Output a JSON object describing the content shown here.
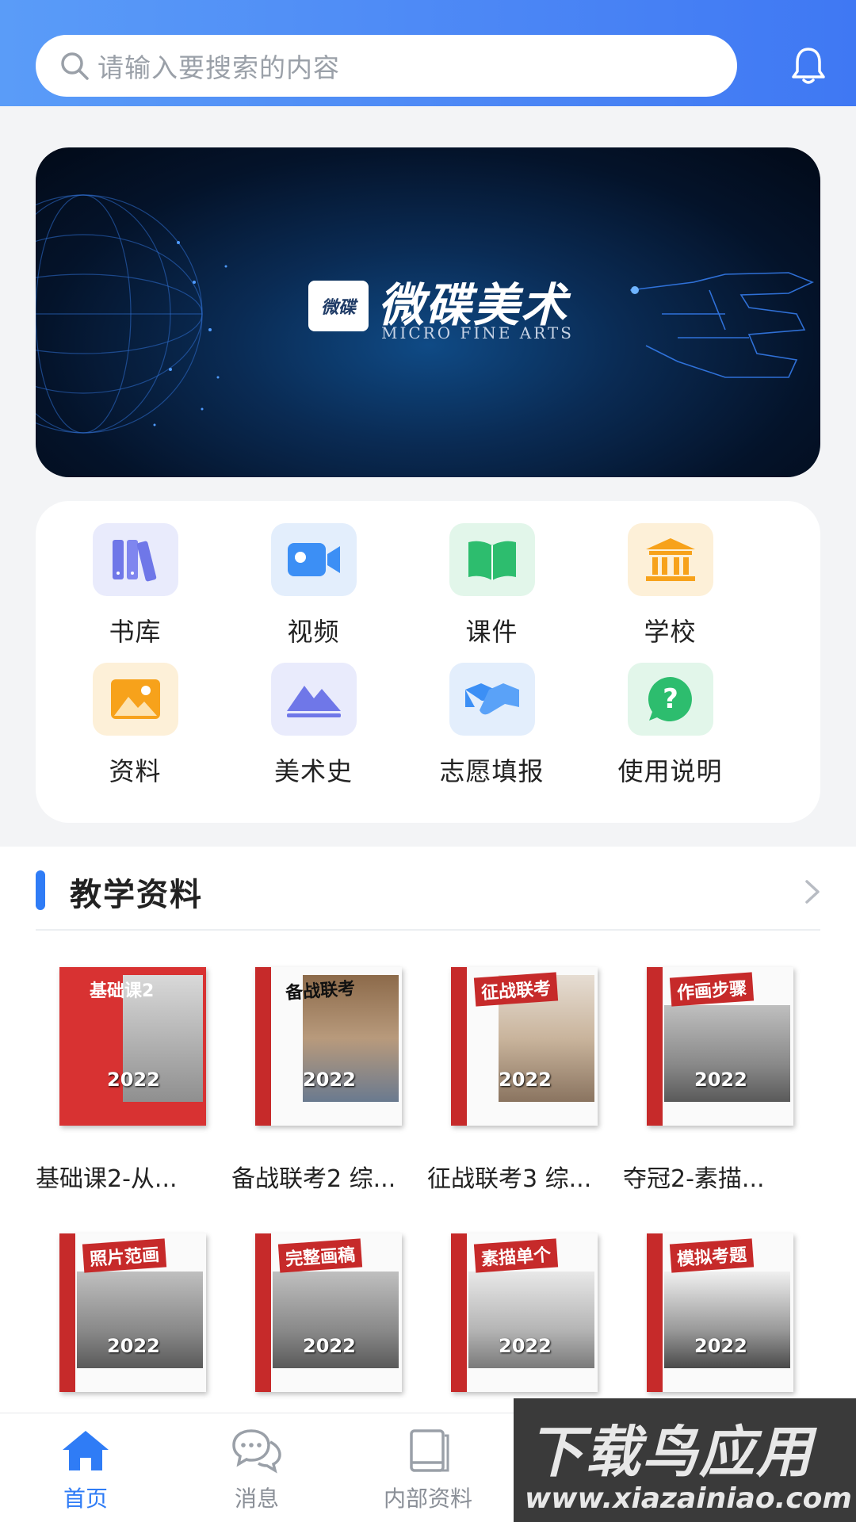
{
  "search": {
    "placeholder": "请输入要搜索的内容"
  },
  "banner": {
    "logo_mark": "微碟",
    "title": "微碟美术",
    "subtitle": "MICRO FINE ARTS"
  },
  "categories": [
    {
      "label": "书库",
      "icon": "books-icon",
      "color": "#6f77e8",
      "bg": "#e9ebfc"
    },
    {
      "label": "视频",
      "icon": "video-camera-icon",
      "color": "#3c8ff5",
      "bg": "#e3eefc"
    },
    {
      "label": "课件",
      "icon": "open-book-icon",
      "color": "#2dbd6e",
      "bg": "#e2f6ea"
    },
    {
      "label": "学校",
      "icon": "school-building-icon",
      "color": "#f7a21b",
      "bg": "#fdf0d8"
    },
    {
      "label": "资料",
      "icon": "image-icon",
      "color": "#f7a21b",
      "bg": "#fdf0d8"
    },
    {
      "label": "美术史",
      "icon": "mountains-icon",
      "color": "#6f77e8",
      "bg": "#e9ebfc"
    },
    {
      "label": "志愿填报",
      "icon": "handshake-icon",
      "color": "#3c8ff5",
      "bg": "#e3eefc"
    },
    {
      "label": "使用说明",
      "icon": "question-bubble-icon",
      "color": "#2dbd6e",
      "bg": "#e2f6ea"
    }
  ],
  "section": {
    "title": "教学资料",
    "books": [
      {
        "caption": "基础课2-从...",
        "cover_title": "基础课2"
      },
      {
        "caption": "备战联考2 综...",
        "cover_title": "备战联考"
      },
      {
        "caption": "征战联考3 综...",
        "cover_title": "征战联考"
      },
      {
        "caption": "夺冠2-素描...",
        "cover_title": "作画步骤"
      },
      {
        "caption": "",
        "cover_title": "照片范画"
      },
      {
        "caption": "",
        "cover_title": "完整画稿"
      },
      {
        "caption": "",
        "cover_title": "素描单个"
      },
      {
        "caption": "",
        "cover_title": "模拟考题"
      }
    ],
    "cover_year": "2022"
  },
  "nav": [
    {
      "label": "首页",
      "icon": "home-icon",
      "active": true
    },
    {
      "label": "消息",
      "icon": "chat-bubbles-icon",
      "active": false
    },
    {
      "label": "内部资料",
      "icon": "notebook-icon",
      "active": false
    }
  ],
  "watermark": {
    "line1": "下载鸟应用",
    "line2": "www.xiazainiao.com"
  },
  "colors": {
    "accent": "#2f7cf6",
    "header_start": "#5a9cf8",
    "header_end": "#3f78f3"
  }
}
